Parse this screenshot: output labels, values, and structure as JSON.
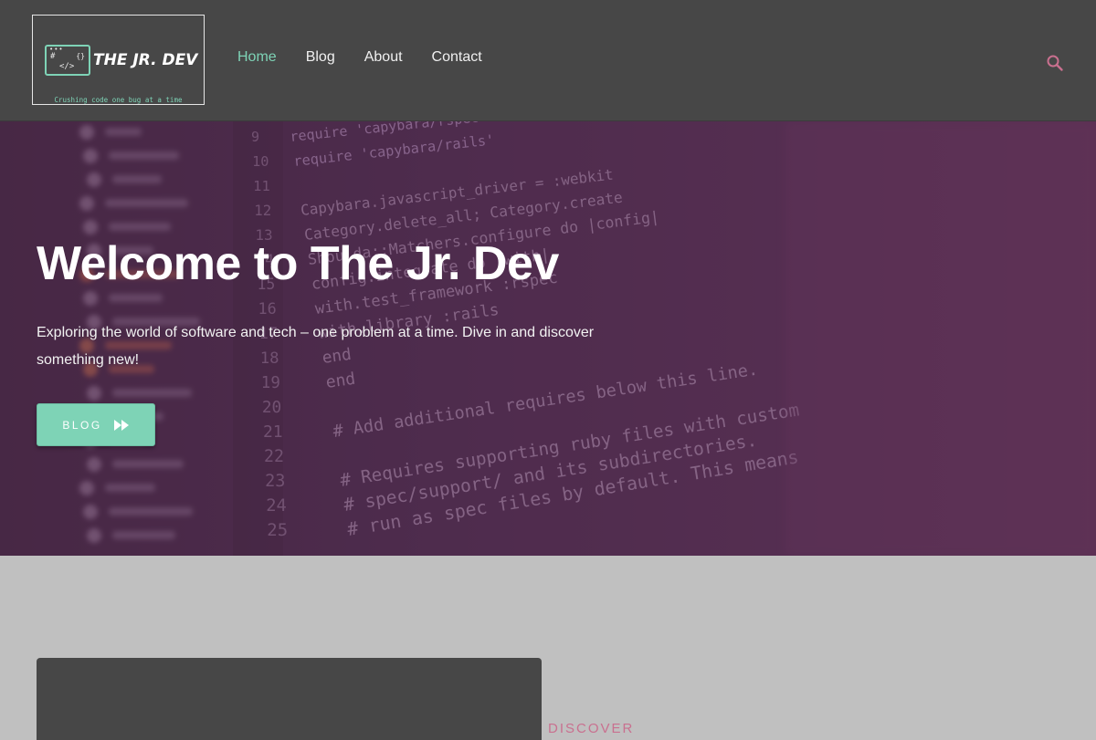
{
  "header": {
    "logo": {
      "title": "THE JR. DEV",
      "tagline": "Crushing code one bug at a time",
      "window_dots": "•••",
      "window_hash": "#",
      "window_braces": "{}",
      "window_tag": "</>"
    },
    "nav": [
      {
        "label": "Home",
        "active": true
      },
      {
        "label": "Blog",
        "active": false
      },
      {
        "label": "About",
        "active": false
      },
      {
        "label": "Contact",
        "active": false
      }
    ],
    "search_icon": "search-icon"
  },
  "hero": {
    "title": "Welcome to The Jr. Dev",
    "subtitle": "Exploring the world of software and tech – one problem at a time. Dive in and discover something new!",
    "button_label": "BLOG",
    "button_icon": "fast-forward-icon",
    "code_lines": [
      {
        "num": "9",
        "code": "require 'capybara/rspec'"
      },
      {
        "num": "10",
        "code": "require 'capybara/rails'"
      },
      {
        "num": "11",
        "code": ""
      },
      {
        "num": "12",
        "code": "Capybara.javascript_driver = :webkit"
      },
      {
        "num": "13",
        "code": "Category.delete_all; Category.create"
      },
      {
        "num": "14",
        "code": "Shoulda::Matchers.configure do |config|"
      },
      {
        "num": "15",
        "code": "  config.integrate do |with|"
      },
      {
        "num": "16",
        "code": "    with.test_framework :rspec"
      },
      {
        "num": "17",
        "code": "    with.library :rails"
      },
      {
        "num": "18",
        "code": "  end"
      },
      {
        "num": "19",
        "code": "end"
      },
      {
        "num": "20",
        "code": ""
      },
      {
        "num": "21",
        "code": "# Add additional requires below this line."
      },
      {
        "num": "22",
        "code": ""
      },
      {
        "num": "23",
        "code": "# Requires supporting ruby files with custom"
      },
      {
        "num": "24",
        "code": "# spec/support/ and its subdirectories."
      },
      {
        "num": "25",
        "code": "# run as spec files by default. This means"
      }
    ]
  },
  "colors": {
    "accent": "#7ed3b6",
    "header_bg": "#474747",
    "hero_overlay": "#5c2852",
    "discover": "#c9708f"
  },
  "lower": {
    "discover_label": "DISCOVER"
  }
}
